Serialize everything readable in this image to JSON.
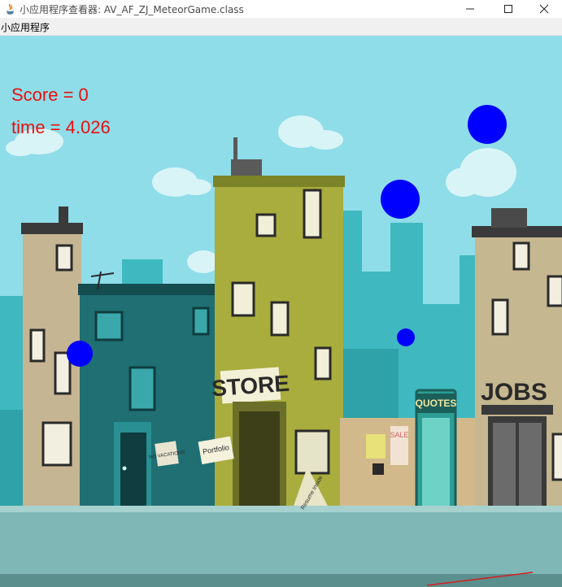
{
  "window": {
    "title": "小应用程序查看器: AV_AF_ZJ_MeteorGame.class",
    "icons": [
      "java-applet-icon",
      "minimize-icon",
      "maximize-icon",
      "close-icon"
    ]
  },
  "menu": {
    "items": [
      "小应用程序"
    ]
  },
  "game": {
    "score_text": "Score = 0",
    "time_text": "time = 4.026",
    "hud_color": "#e81010",
    "meteor_color": "#0000ff",
    "sky_color": "#8fdde9",
    "signs": {
      "store": "STORE",
      "quotes": "QUOTES",
      "jobs": "JOBS",
      "no_vacations": "NO VACATIONS",
      "portfolio": "Portfolio",
      "resume": "Resume Inside",
      "sale": "SALE"
    }
  }
}
